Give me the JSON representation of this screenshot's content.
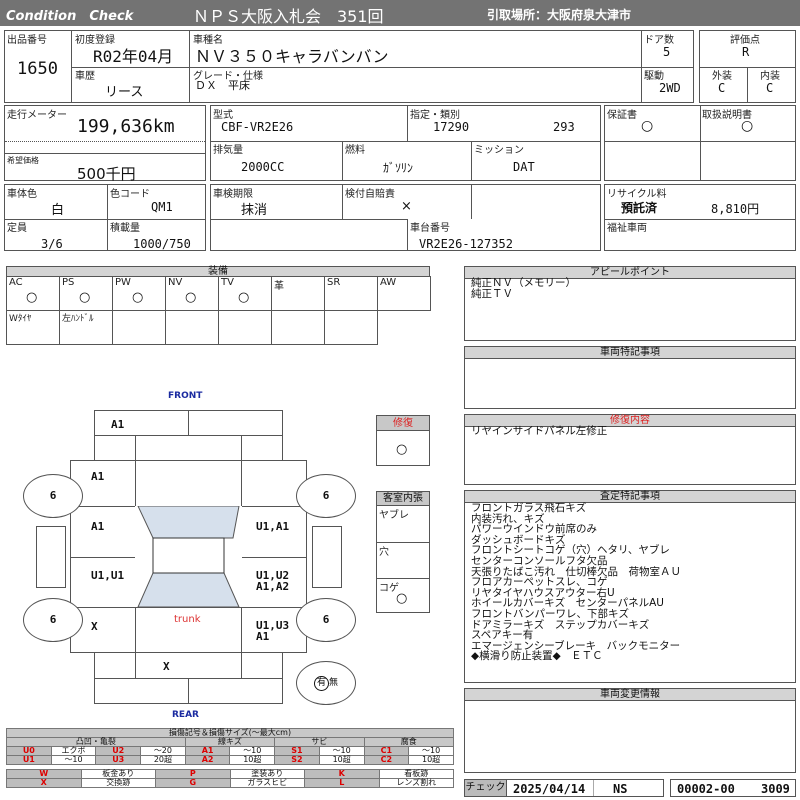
{
  "header": {
    "brand": "Condition　Check",
    "title": "ＮＰＳ大阪入札会　351回",
    "pickup": "引取場所：大阪府泉大津市"
  },
  "basic": {
    "lot_label": "出品番号",
    "lot": "1650",
    "first_reg_label": "初度登録",
    "first_reg": "R02年04月",
    "model_label": "車種名",
    "model": "ＮＶ３５０キャラバンバン",
    "doors_label": "ドア数",
    "doors": "5",
    "history_label": "車歴",
    "history": "リース",
    "grade_label": "グレード・仕様",
    "grade": "ＤＸ　平床",
    "drive_label": "駆動",
    "drive": "2WD",
    "score_label": "評価点",
    "score": "R",
    "ext_label": "外装",
    "ext": "C",
    "int_label": "内装",
    "int": "C"
  },
  "spec": {
    "mileage_label": "走行メーター",
    "mileage": "199,636km",
    "price_label": "希望価格",
    "price": "500千円",
    "type_label": "型式",
    "type": "CBF-VR2E26",
    "designation_label": "指定・類別",
    "designation": "17290",
    "class": "293",
    "disp_label": "排気量",
    "disp": "2000CC",
    "fuel_label": "燃料",
    "fuel": "ｶﾞｿﾘﾝ",
    "mission_label": "ミッション",
    "mission": "DAT",
    "warranty_label": "保証書",
    "warranty": "○",
    "manual_label": "取扱説明書",
    "manual": "○"
  },
  "body": {
    "color_label": "車体色",
    "color": "白",
    "code_label": "色コード",
    "code": "QM1",
    "capacity_label": "定員",
    "capacity": "3/6",
    "load_label": "積載量",
    "load": "1000/750",
    "inspection_label": "車検期限",
    "inspection": "抹消",
    "insurance_label": "検付自賠責",
    "insurance": "×",
    "chassis_label": "車台番号",
    "chassis": "VR2E26-127352",
    "recycle_label": "リサイクル料",
    "recycle_status": "預託済",
    "recycle_fee": "8,810円",
    "welfare_label": "福祉車両"
  },
  "equipment": {
    "title": "装備",
    "row1": [
      {
        "label": "AC",
        "mark": "○"
      },
      {
        "label": "PS",
        "mark": "○"
      },
      {
        "label": "PW",
        "mark": "○"
      },
      {
        "label": "NV",
        "mark": "○"
      },
      {
        "label": "TV",
        "mark": "○"
      },
      {
        "label": "革",
        "mark": ""
      },
      {
        "label": "SR",
        "mark": ""
      },
      {
        "label": "AW",
        "mark": ""
      }
    ],
    "row2": [
      "Wﾀｲﾔ",
      "左ﾊﾝﾄﾞﾙ",
      "",
      "",
      "",
      "",
      ""
    ]
  },
  "diagram": {
    "front": "FRONT",
    "rear": "REAR",
    "trunk": "trunk",
    "front_bumper_left": "A1",
    "left_front_fender": "A1",
    "left_front_door": "A1",
    "left_rear_door": "U1,U1",
    "left_quarter": "X",
    "right_front_door": "U1,A1",
    "right_rear_door": "U1,U2\nA1,A2",
    "right_quarter": "U1,U3\nA1",
    "rear_gate": "X",
    "tires": [
      "6",
      "6",
      "6",
      "6"
    ],
    "spare_yes": "有",
    "spare_no": "無"
  },
  "repair": {
    "label": "修復",
    "mark": "○"
  },
  "cabin": {
    "label": "客室内張",
    "tear": "ヤブレ",
    "hole": "穴",
    "burn": "コゲ",
    "burn_mark": "○"
  },
  "legend": {
    "title": "損傷記号＆損傷サイズ(〜最大cm)",
    "groups": [
      "凸凹・亀裂",
      "線キズ",
      "サビ",
      "腐食"
    ],
    "r1": [
      "U0",
      "エクボ",
      "U2",
      "〜20",
      "A1",
      "〜10",
      "S1",
      "〜10",
      "C1",
      "〜10"
    ],
    "r2": [
      "U1",
      "〜10",
      "U3",
      "20超",
      "A2",
      "10超",
      "S2",
      "10超",
      "C2",
      "10超"
    ],
    "r3": [
      "W",
      "板金あり",
      "P",
      "塗装あり",
      "K",
      "看板跡"
    ],
    "r4": [
      "X",
      "交換跡",
      "G",
      "ガラスヒビ",
      "L",
      "レンズ割れ"
    ]
  },
  "appeal": {
    "title": "アピールポイント",
    "text": "純正ＮＶ（メモリー）\n純正ＴＶ"
  },
  "notes": {
    "title": "車両特記事項"
  },
  "repair_detail": {
    "title": "修復内容",
    "text": "リヤインサイドパネル左修正"
  },
  "assessment": {
    "title": "査定特記事項",
    "text": "フロントガラス飛石キズ\n内装汚れ、キズ\nパワーウインドウ前席のみ\nダッシュボードキズ\nフロントシートコゲ（穴）ヘタリ、ヤブレ\nセンターコンソールフタ欠品\n天張りたばこ汚れ　仕切棒欠品　荷物室ＡＵ\nフロアカーペットスレ、コゲ\nリヤタイヤハウスアウター右U\nホイールカバーキズ　センターパネルAU\nフロントバンパーワレ、下部キズ\nドアミラーキズ　ステップカバーキズ\nスペアキー有\nエマージェンシーブレーキ　バックモニター\n◆横滑り防止装置◆　ＥＴＣ"
  },
  "changes": {
    "title": "車両変更情報"
  },
  "footer": {
    "check_label": "チェック",
    "date": "2025/04/14",
    "inspector": "NS",
    "code": "00002-00",
    "number": "3009"
  }
}
